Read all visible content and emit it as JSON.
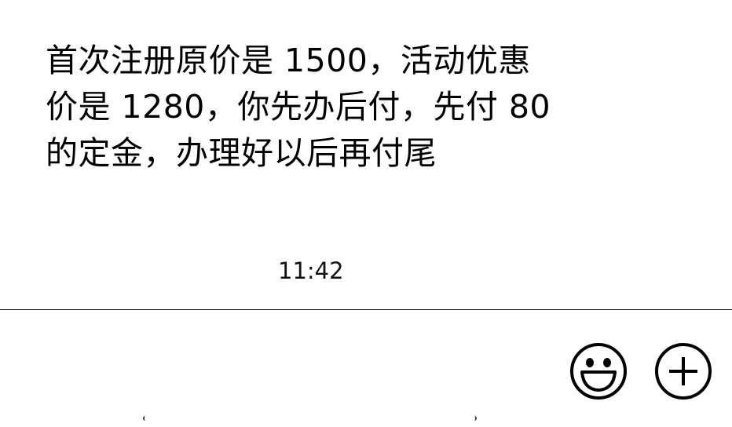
{
  "chat": {
    "message": {
      "lines": [
        "首次注册原价是 1500，活动优惠",
        "价是 1280，你先办后付，先付 80",
        "的定金，办理好以后再付尾"
      ]
    },
    "timestamp": "11:42"
  },
  "input_bar": {
    "icons": {
      "emoji": "emoji-smile-icon",
      "plus": "plus-circle-icon"
    }
  },
  "colors": {
    "background": "#ffffff",
    "text": "#000000",
    "divider": "#111111"
  }
}
